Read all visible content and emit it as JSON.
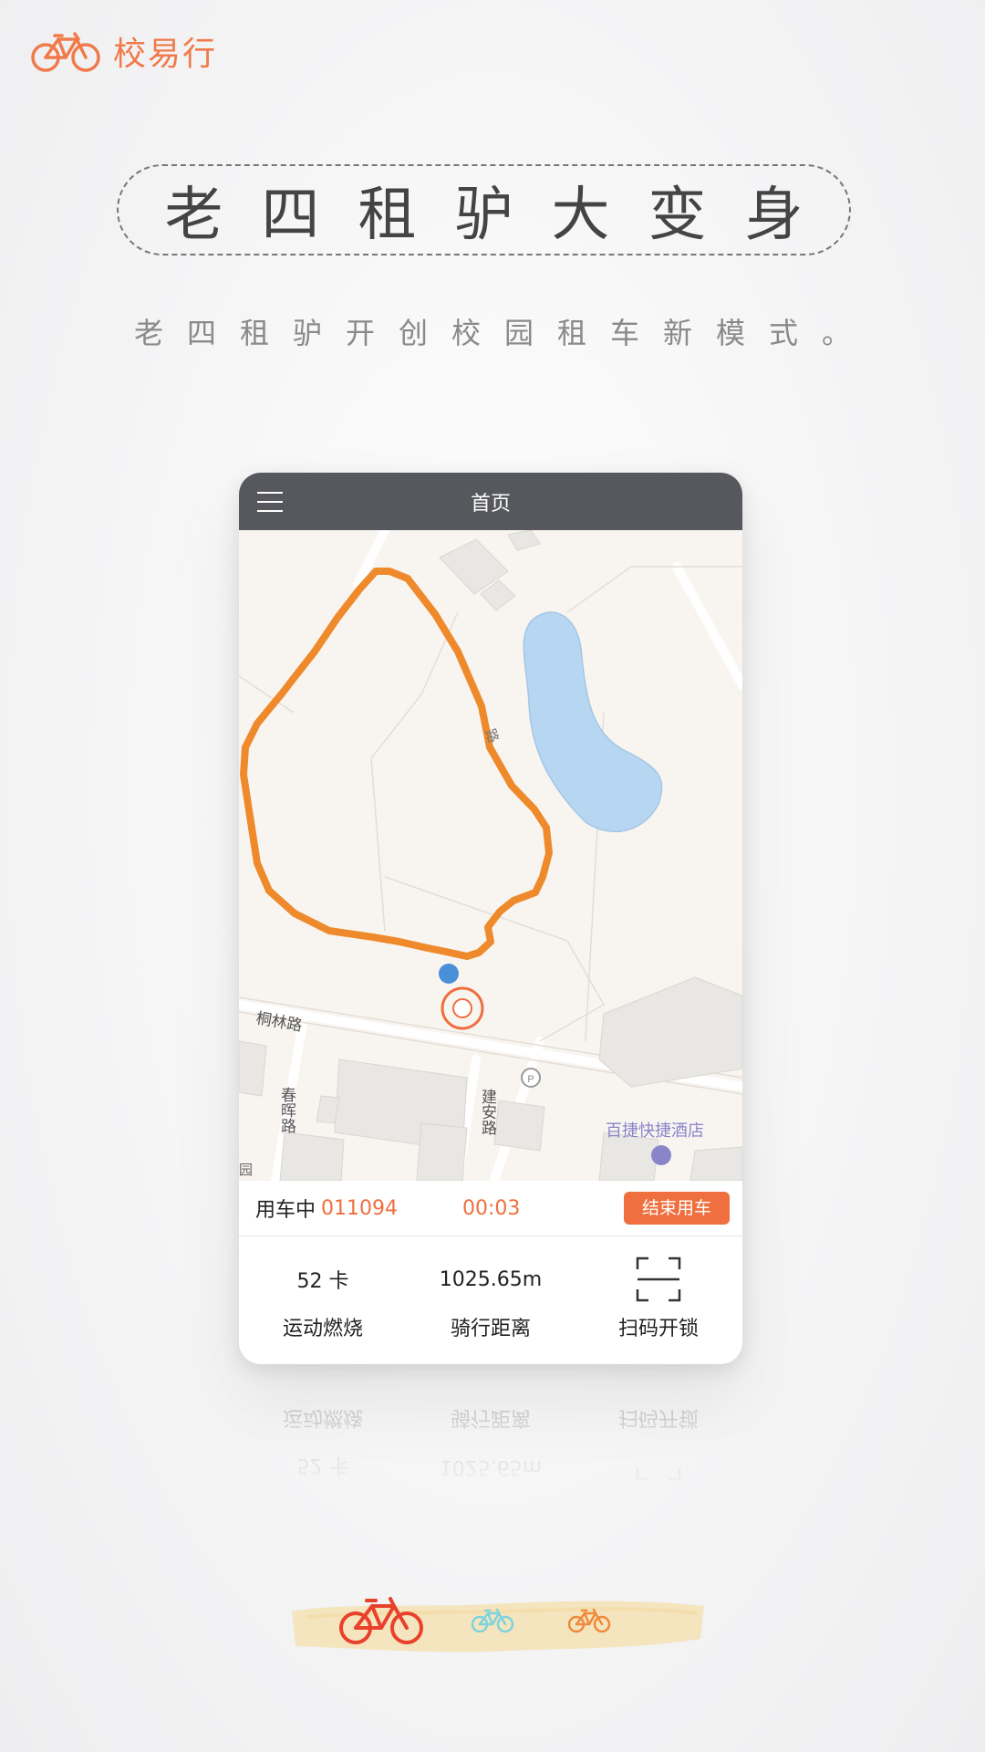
{
  "brand": {
    "name": "校易行",
    "logo_icon": "bicycle-icon",
    "color": "#f07a4a"
  },
  "headline": "老四租驴大变身",
  "subline": "老四租驴开创校园租车新模式。",
  "app": {
    "topbar": {
      "title": "首页",
      "menu_icon": "hamburger-icon",
      "background": "#56585d"
    },
    "map": {
      "labels": {
        "tonglin_road": "桐林路",
        "chunhui_road": "春晖路",
        "jianan_road": "建安路",
        "hotel": "百捷快捷酒店",
        "corner_label": "园",
        "inner_road": "路"
      },
      "route_color": "#ef8a2c",
      "lake_color": "#b7d6f1"
    },
    "status": {
      "label": "用车中",
      "bike_id": "011094",
      "timer": "00:03",
      "end_button": "结束用车",
      "accent": "#ef6f3e"
    },
    "stats": [
      {
        "value": "52 卡",
        "label": "运动燃烧"
      },
      {
        "value": "1025.65m",
        "label": "骑行距离"
      },
      {
        "value_icon": "scan-icon",
        "label": "扫码开锁"
      }
    ]
  },
  "bike_selector": [
    {
      "icon": "bicycle-icon",
      "color": "#e8412c"
    },
    {
      "icon": "bicycle-icon",
      "color": "#7fd3dc"
    },
    {
      "icon": "bicycle-icon",
      "color": "#ef8a3c"
    }
  ]
}
